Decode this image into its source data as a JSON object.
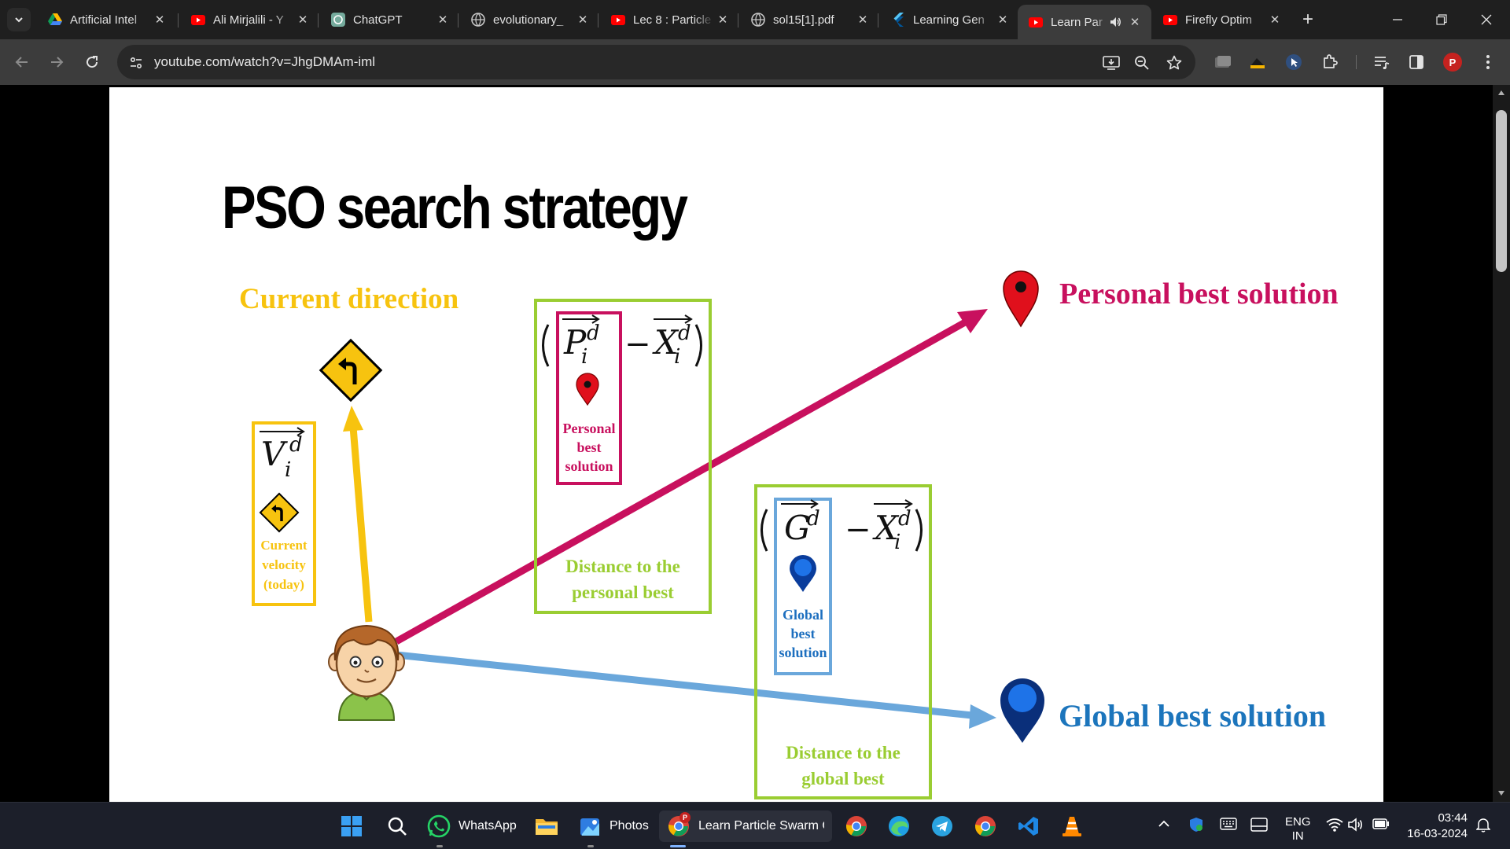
{
  "browser": {
    "tabs": [
      {
        "title": "Artificial Intel",
        "icon": "drive-icon",
        "active": false
      },
      {
        "title": "Ali Mirjalili - Y",
        "icon": "youtube-icon",
        "active": false
      },
      {
        "title": "ChatGPT",
        "icon": "chatgpt-icon",
        "active": false
      },
      {
        "title": "evolutionary_",
        "icon": "globe-icon",
        "active": false
      },
      {
        "title": "Lec 8 : Particle",
        "icon": "youtube-icon",
        "active": false
      },
      {
        "title": "sol15[1].pdf",
        "icon": "globe-icon",
        "active": false
      },
      {
        "title": "Learning Gen",
        "icon": "flutter-icon",
        "active": false
      },
      {
        "title": "Learn Par",
        "icon": "youtube-icon",
        "active": true,
        "audio": true
      },
      {
        "title": "Firefly Optim",
        "icon": "youtube-icon",
        "active": false
      }
    ],
    "address": "youtube.com/watch?v=JhgDMAm-iml",
    "profile_initial": "P",
    "colors": {
      "frame": "#1f1f1f",
      "toolbar": "#3c3c3c",
      "omnibox": "#282828",
      "youtube_red": "#ff0000"
    }
  },
  "slide": {
    "title": "PSO search strategy",
    "current_direction": "Current direction",
    "velocity_box": {
      "symbol": "V",
      "sup": "d",
      "sub": "i",
      "caption_lines": [
        "Current",
        "velocity",
        "(today)"
      ]
    },
    "personal_box": {
      "term_p": {
        "symbol": "P",
        "sup": "d",
        "sub": "i"
      },
      "minus": "−",
      "term_x": {
        "symbol": "X",
        "sup": "d",
        "sub": "i"
      },
      "inner_caption_lines": [
        "Personal",
        "best",
        "solution"
      ],
      "caption_lines": [
        "Distance to the",
        "personal best"
      ]
    },
    "global_box": {
      "term_g": {
        "symbol": "G",
        "sup": "d"
      },
      "minus": "−",
      "term_x": {
        "symbol": "X",
        "sup": "d",
        "sub": "i"
      },
      "inner_caption_lines": [
        "Global",
        "best",
        "solution"
      ],
      "caption_lines": [
        "Distance to the",
        "global best"
      ]
    },
    "personal_best_label": "Personal best solution",
    "global_best_label": "Global best solution",
    "colors": {
      "yellow": "#f7c30f",
      "crimson": "#c8105e",
      "blue": "#6aa7db",
      "green": "#9acd32",
      "dark_blue": "#1d6fbf",
      "label_personal": "#c8105e",
      "label_global": "#1c75bc"
    }
  },
  "taskbar": {
    "apps": [
      {
        "name": "start",
        "icon": "windows-icon"
      },
      {
        "name": "search",
        "icon": "search-icon"
      },
      {
        "name": "WhatsApp",
        "label": "WhatsApp",
        "icon": "whatsapp-icon"
      },
      {
        "name": "file-explorer",
        "icon": "folder-icon"
      },
      {
        "name": "Photos",
        "label": "Photos",
        "icon": "photos-icon"
      },
      {
        "name": "chrome-window",
        "label": "Learn Particle Swarm Op",
        "icon": "chrome-icon",
        "badge": "P"
      },
      {
        "name": "chrome-2",
        "icon": "chrome-icon"
      },
      {
        "name": "edge",
        "icon": "edge-icon"
      },
      {
        "name": "telegram",
        "icon": "telegram-icon"
      },
      {
        "name": "chrome-3",
        "icon": "chrome-icon"
      },
      {
        "name": "vscode",
        "icon": "vscode-icon"
      },
      {
        "name": "vlc",
        "icon": "vlc-icon"
      }
    ],
    "language": "ENG",
    "region": "IN",
    "time": "03:44",
    "date": "16-03-2024"
  }
}
